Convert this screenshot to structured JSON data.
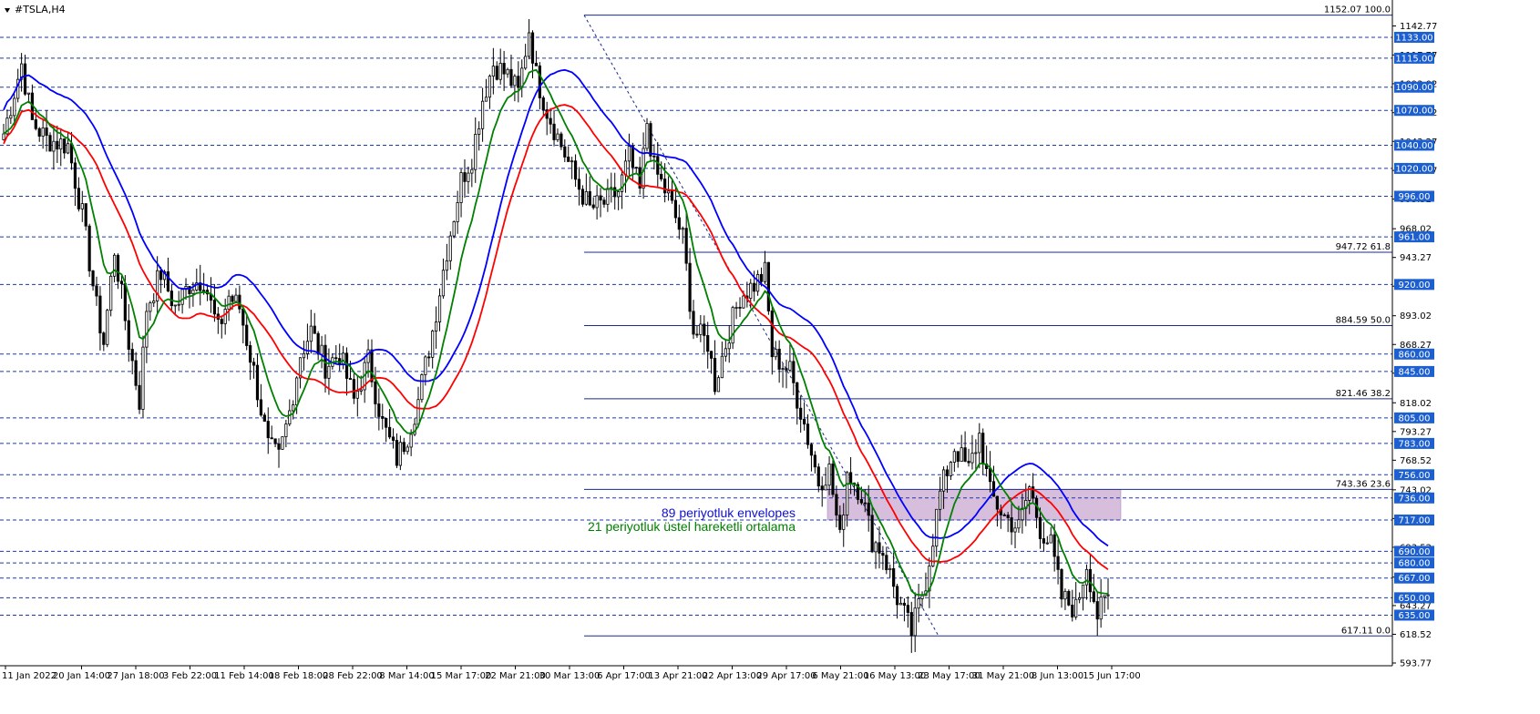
{
  "chart_data": {
    "type": "candlestick",
    "symbol_label": "#TSLA,H4",
    "symbol_icon": "triangle-down-icon",
    "ylim": [
      593.77,
      1162
    ],
    "price_ticks": [
      "1142.77",
      "1117.77",
      "1093.02",
      "1068.02",
      "1043.27",
      "1018.27",
      "993.52",
      "968.02",
      "943.27",
      "918.52",
      "893.02",
      "868.27",
      "843.52",
      "818.02",
      "793.27",
      "768.52",
      "743.02",
      "718.27",
      "693.52",
      "667.77",
      "643.27",
      "618.52",
      "593.77"
    ],
    "time_labels": [
      "11 Jan 2022",
      "20 Jan 14:00",
      "27 Jan 18:00",
      "3 Feb 22:00",
      "11 Feb 14:00",
      "18 Feb 18:00",
      "28 Feb 22:00",
      "8 Mar 14:00",
      "15 Mar 17:00",
      "22 Mar 21:00",
      "30 Mar 13:00",
      "6 Apr 17:00",
      "13 Apr 21:00",
      "22 Apr 13:00",
      "29 Apr 17:00",
      "6 May 21:00",
      "16 May 13:00",
      "23 May 17:00",
      "31 May 21:00",
      "8 Jun 13:00",
      "15 Jun 17:00"
    ],
    "support_resistance_levels": [
      {
        "label": "1133.00",
        "value": 1133
      },
      {
        "label": "1115.00",
        "value": 1115
      },
      {
        "label": "1090.00",
        "value": 1090
      },
      {
        "label": "1070.00",
        "value": 1070
      },
      {
        "label": "1040.00",
        "value": 1040
      },
      {
        "label": "1020.00",
        "value": 1020
      },
      {
        "label": "996.00",
        "value": 996
      },
      {
        "label": "961.00",
        "value": 961
      },
      {
        "label": "920.00",
        "value": 920
      },
      {
        "label": "860.00",
        "value": 860
      },
      {
        "label": "845.00",
        "value": 845
      },
      {
        "label": "805.00",
        "value": 805
      },
      {
        "label": "783.00",
        "value": 783
      },
      {
        "label": "756.00",
        "value": 756
      },
      {
        "label": "736.00",
        "value": 736
      },
      {
        "label": "717.00",
        "value": 717
      },
      {
        "label": "690.00",
        "value": 690
      },
      {
        "label": "680.00",
        "value": 680
      },
      {
        "label": "667.00",
        "value": 667
      },
      {
        "label": "650.00",
        "value": 650
      },
      {
        "label": "635.00",
        "value": 635
      }
    ],
    "fibonacci_levels": [
      {
        "label": "1152.07 100.0",
        "value": 1152.07
      },
      {
        "label": "947.72 61.8",
        "value": 947.72
      },
      {
        "label": "884.59 50.0",
        "value": 884.59
      },
      {
        "label": "821.46 38.2",
        "value": 821.46
      },
      {
        "label": "743.36 23.6",
        "value": 743.36
      },
      {
        "label": "617.11 0.0",
        "value": 617.11
      }
    ],
    "legend": [
      {
        "text": "89 periyotluk envelopes",
        "color": "#1010d0"
      },
      {
        "text": "21 periyotluk üstel hareketli ortalama",
        "color": "#008000"
      }
    ],
    "highlight_zone": {
      "from": 717,
      "to": 743.36
    },
    "colors": {
      "levels": "#1c3aa8",
      "label_box": "#1c5fd0",
      "envelope_upper": "#0000ff",
      "envelope_lower": "#ff0000",
      "ema": "#008000",
      "candles": "#000000",
      "zone": "#c8a8d0"
    },
    "price_anchors": [
      [
        0,
        1050
      ],
      [
        5,
        1110
      ],
      [
        8,
        1060
      ],
      [
        12,
        1045
      ],
      [
        18,
        1040
      ],
      [
        22,
        980
      ],
      [
        26,
        900
      ],
      [
        28,
        870
      ],
      [
        31,
        950
      ],
      [
        35,
        870
      ],
      [
        38,
        820
      ],
      [
        40,
        900
      ],
      [
        44,
        930
      ],
      [
        48,
        900
      ],
      [
        52,
        920
      ],
      [
        56,
        925
      ],
      [
        60,
        880
      ],
      [
        63,
        910
      ],
      [
        66,
        900
      ],
      [
        70,
        845
      ],
      [
        74,
        780
      ],
      [
        77,
        770
      ],
      [
        80,
        810
      ],
      [
        83,
        860
      ],
      [
        86,
        880
      ],
      [
        90,
        850
      ],
      [
        94,
        860
      ],
      [
        98,
        820
      ],
      [
        102,
        855
      ],
      [
        106,
        800
      ],
      [
        110,
        770
      ],
      [
        113,
        790
      ],
      [
        116,
        820
      ],
      [
        120,
        880
      ],
      [
        124,
        950
      ],
      [
        128,
        1010
      ],
      [
        131,
        1030
      ],
      [
        134,
        1080
      ],
      [
        137,
        1110
      ],
      [
        141,
        1100
      ],
      [
        144,
        1085
      ],
      [
        147,
        1140
      ],
      [
        149,
        1100
      ],
      [
        152,
        1070
      ],
      [
        156,
        1040
      ],
      [
        160,
        1010
      ],
      [
        164,
        985
      ],
      [
        168,
        990
      ],
      [
        172,
        1000
      ],
      [
        175,
        1030
      ],
      [
        178,
        1000
      ],
      [
        180,
        1060
      ],
      [
        182,
        1020
      ],
      [
        186,
        995
      ],
      [
        190,
        960
      ],
      [
        193,
        880
      ],
      [
        197,
        870
      ],
      [
        199,
        835
      ],
      [
        203,
        880
      ],
      [
        206,
        910
      ],
      [
        210,
        920
      ],
      [
        213,
        930
      ],
      [
        215,
        860
      ],
      [
        220,
        845
      ],
      [
        224,
        800
      ],
      [
        228,
        750
      ],
      [
        231,
        760
      ],
      [
        234,
        700
      ],
      [
        236,
        760
      ],
      [
        240,
        740
      ],
      [
        243,
        700
      ],
      [
        246,
        690
      ],
      [
        250,
        650
      ],
      [
        254,
        620
      ],
      [
        258,
        665
      ],
      [
        262,
        740
      ],
      [
        266,
        780
      ],
      [
        270,
        760
      ],
      [
        273,
        790
      ],
      [
        276,
        740
      ],
      [
        280,
        720
      ],
      [
        284,
        710
      ],
      [
        287,
        745
      ],
      [
        290,
        710
      ],
      [
        293,
        695
      ],
      [
        296,
        650
      ],
      [
        300,
        640
      ],
      [
        303,
        680
      ],
      [
        306,
        635
      ],
      [
        309,
        650
      ]
    ]
  }
}
